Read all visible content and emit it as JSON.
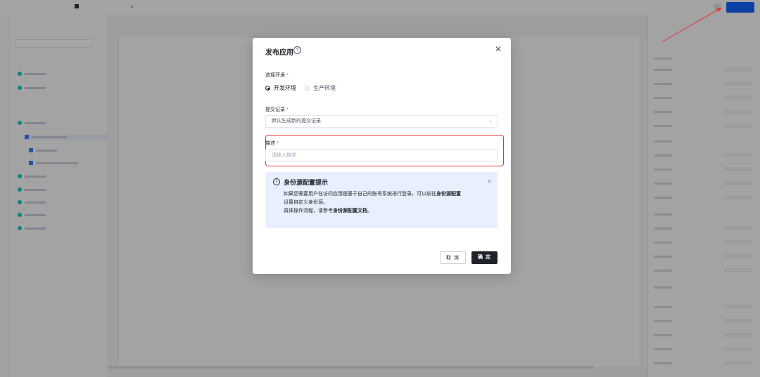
{
  "modal": {
    "title": "发布应用",
    "env_label": "选择环境",
    "env_options": [
      "开发环境",
      "生产环境"
    ],
    "env_selected": "开发环境",
    "commit_label": "提交记录",
    "commit_value": "默认生成新的提交记录",
    "desc_label": "描述",
    "desc_placeholder": "请输入描述",
    "required_mark": "*",
    "notice": {
      "title": "身份源配置提示",
      "line1_a": "如果您需要用户在访问应用是基于自己的账号系统进行登录，可以前往",
      "line1_link": "身份源配置",
      "line2": "设置自定义身份源。",
      "line3_a": "具体操作流程，请参考",
      "line3_link": "身份源配置文档",
      "line3_b": "。"
    },
    "cancel_label": "取 消",
    "ok_label": "确 定"
  },
  "colors": {
    "highlight": "#e5342d",
    "primary": "#1f2329",
    "notice_bg": "#e8efff",
    "publish_button": "#1664ff"
  }
}
